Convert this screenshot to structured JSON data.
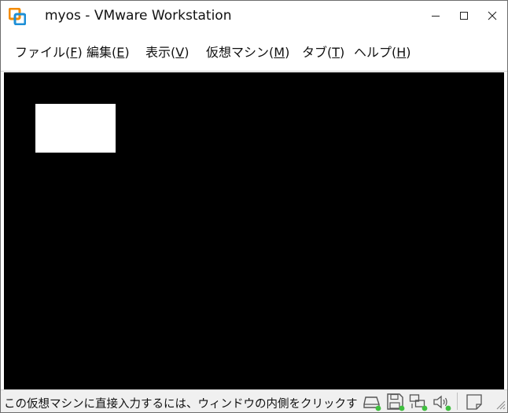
{
  "window": {
    "title": "myos - VMware Workstation",
    "app_icon": "vmware-workstation-icon"
  },
  "title_controls": {
    "minimize_icon": "minimize-icon",
    "maximize_icon": "maximize-icon",
    "close_icon": "close-icon"
  },
  "menu": {
    "items": [
      {
        "label": "ファイル(",
        "key": "F",
        "suffix": ")"
      },
      {
        "label": "編集(",
        "key": "E",
        "suffix": ")"
      },
      {
        "label": "表示(",
        "key": "V",
        "suffix": ")"
      },
      {
        "label": "仮想マシン(",
        "key": "M",
        "suffix": ")"
      },
      {
        "label": "タブ(",
        "key": "T",
        "suffix": ")"
      },
      {
        "label": "ヘルプ(",
        "key": "H",
        "suffix": ")"
      }
    ]
  },
  "status": {
    "hint": "この仮想マシンに直接入力するには、ウィンドウの内側をクリックす",
    "devices": [
      {
        "icon": "hard-disk-icon",
        "active": true
      },
      {
        "icon": "floppy-disk-icon",
        "active": true
      },
      {
        "icon": "network-adapter-icon",
        "active": true
      },
      {
        "icon": "sound-card-icon",
        "active": true
      },
      {
        "icon": "message-log-icon",
        "active": false
      }
    ]
  },
  "colors": {
    "console_bg": "#000000",
    "active_led": "#3fbf3f",
    "vmware_orange": "#f38b00",
    "vmware_blue": "#1d8fd6"
  }
}
